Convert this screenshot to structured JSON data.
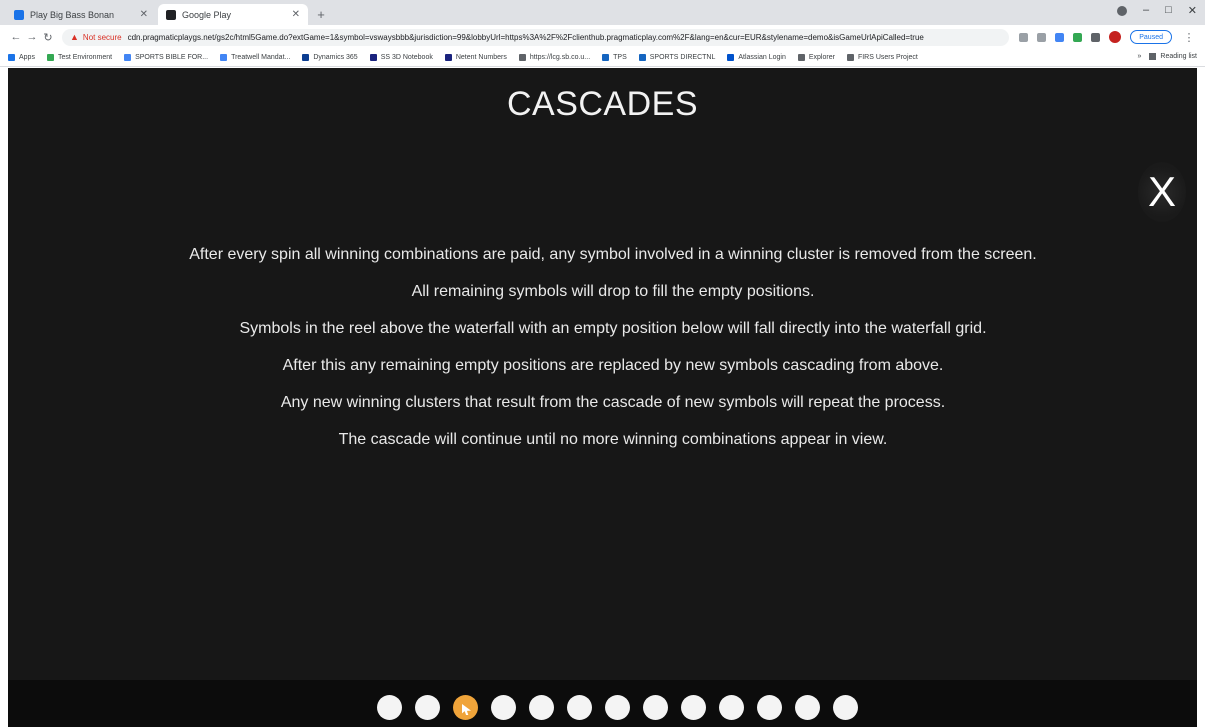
{
  "browser": {
    "tabs": [
      {
        "title": "Play Big Bass Bonan",
        "favicon_color": "#1a73e8",
        "active": false
      },
      {
        "title": "Google Play",
        "favicon_color": "#202124",
        "active": true
      }
    ],
    "not_secure_label": "Not secure",
    "url": "cdn.pragmaticplaygs.net/gs2c/html5Game.do?extGame=1&symbol=vswaysbbb&jurisdiction=99&lobbyUrl=https%3A%2F%2Fclienthub.pragmaticplay.com%2F&lang=en&cur=EUR&stylename=demo&isGameUrlApiCalled=true",
    "paused_label": "Paused",
    "bookmarks": [
      {
        "label": "Apps",
        "color": "#1a73e8"
      },
      {
        "label": "Test Environment",
        "color": "#34a853"
      },
      {
        "label": "SPORTS BIBLE FOR...",
        "color": "#4285f4"
      },
      {
        "label": "Treatwell Mandat...",
        "color": "#4285f4"
      },
      {
        "label": "Dynamics 365",
        "color": "#0b3d91"
      },
      {
        "label": "SS 3D Notebook",
        "color": "#1a237e"
      },
      {
        "label": "Netent Numbers",
        "color": "#1a237e"
      },
      {
        "label": "https://lcg.sb.co.u...",
        "color": "#5f6368"
      },
      {
        "label": "TPS",
        "color": "#1565c0"
      },
      {
        "label": "SPORTS DIRECTNL",
        "color": "#1565c0"
      },
      {
        "label": "Atlassian Login",
        "color": "#0052cc"
      },
      {
        "label": "Explorer",
        "color": "#5f6368"
      },
      {
        "label": "FIRS Users Project",
        "color": "#5f6368"
      }
    ],
    "other_bookmarks_label": "Reading list"
  },
  "game": {
    "title": "CASCADES",
    "close_label": "X",
    "paragraphs": [
      "After every spin all winning combinations are paid, any symbol involved in a winning cluster is removed from the screen.",
      "All remaining symbols will drop to fill the empty positions.",
      "Symbols in the reel above the waterfall with an empty position below will fall directly into the waterfall grid.",
      "After this any remaining empty positions are replaced by new symbols cascading from above.",
      "Any new winning clusters that result from the cascade of new symbols will repeat the process.",
      "The cascade will continue until no more winning combinations appear in view."
    ],
    "page_count": 13,
    "active_page": 3,
    "colors": {
      "background": "#171717",
      "dot": "#f4f4f4",
      "dot_active": "#f0a43a"
    }
  }
}
